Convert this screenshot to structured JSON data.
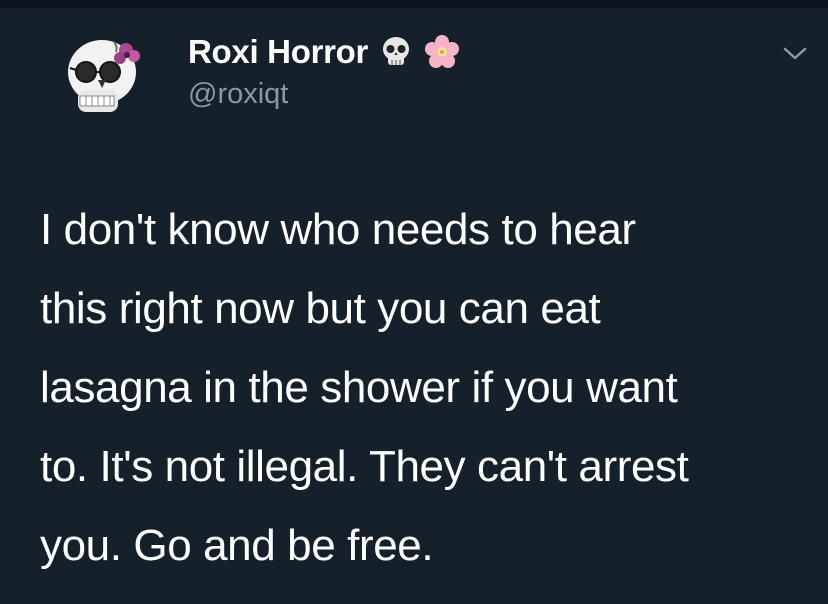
{
  "colors": {
    "background": "#15202b",
    "text_primary": "#ffffff",
    "text_secondary": "#8899a6",
    "top_strip": "#0d141c"
  },
  "author": {
    "display_name": "Roxi Horror",
    "handle": "@roxiqt",
    "avatar_icon": "skull-with-flower-avatar",
    "name_emojis": [
      "skull-emoji-icon",
      "cherry-blossom-emoji-icon"
    ]
  },
  "menu": {
    "icon": "chevron-down-icon"
  },
  "tweet": {
    "lines": [
      "I don't know who needs to hear",
      "this right now but you can eat",
      "lasagna in the shower if you want",
      "to. It's not illegal. They can't arrest",
      "you. Go and be free."
    ]
  }
}
